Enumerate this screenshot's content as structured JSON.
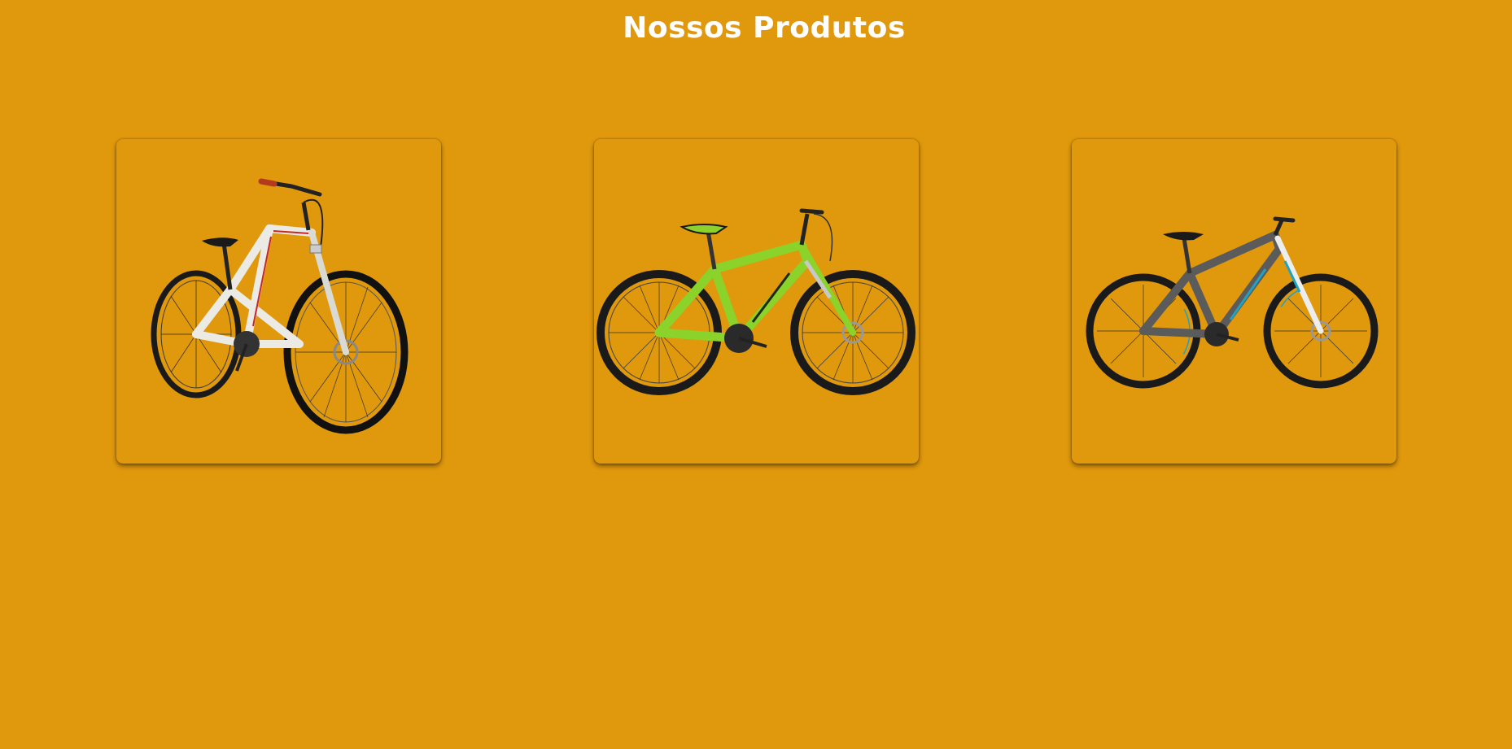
{
  "header": {
    "title": "Nossos Produtos"
  },
  "products": [
    {
      "name": "white-mountain-bike",
      "image_icon": "white-bicycle-icon",
      "frame_color": "#ECEAE4",
      "accent_color": "#C62828"
    },
    {
      "name": "green-mountain-bike",
      "image_icon": "green-bicycle-icon",
      "frame_color": "#8BD32A",
      "accent_color": "#1E2A10"
    },
    {
      "name": "grey-mountain-bike",
      "image_icon": "grey-bicycle-icon",
      "frame_color": "#5B5B5B",
      "accent_color": "#1FA3C4"
    }
  ],
  "colors": {
    "background": "#E0980D",
    "title": "#FFFFFF"
  }
}
